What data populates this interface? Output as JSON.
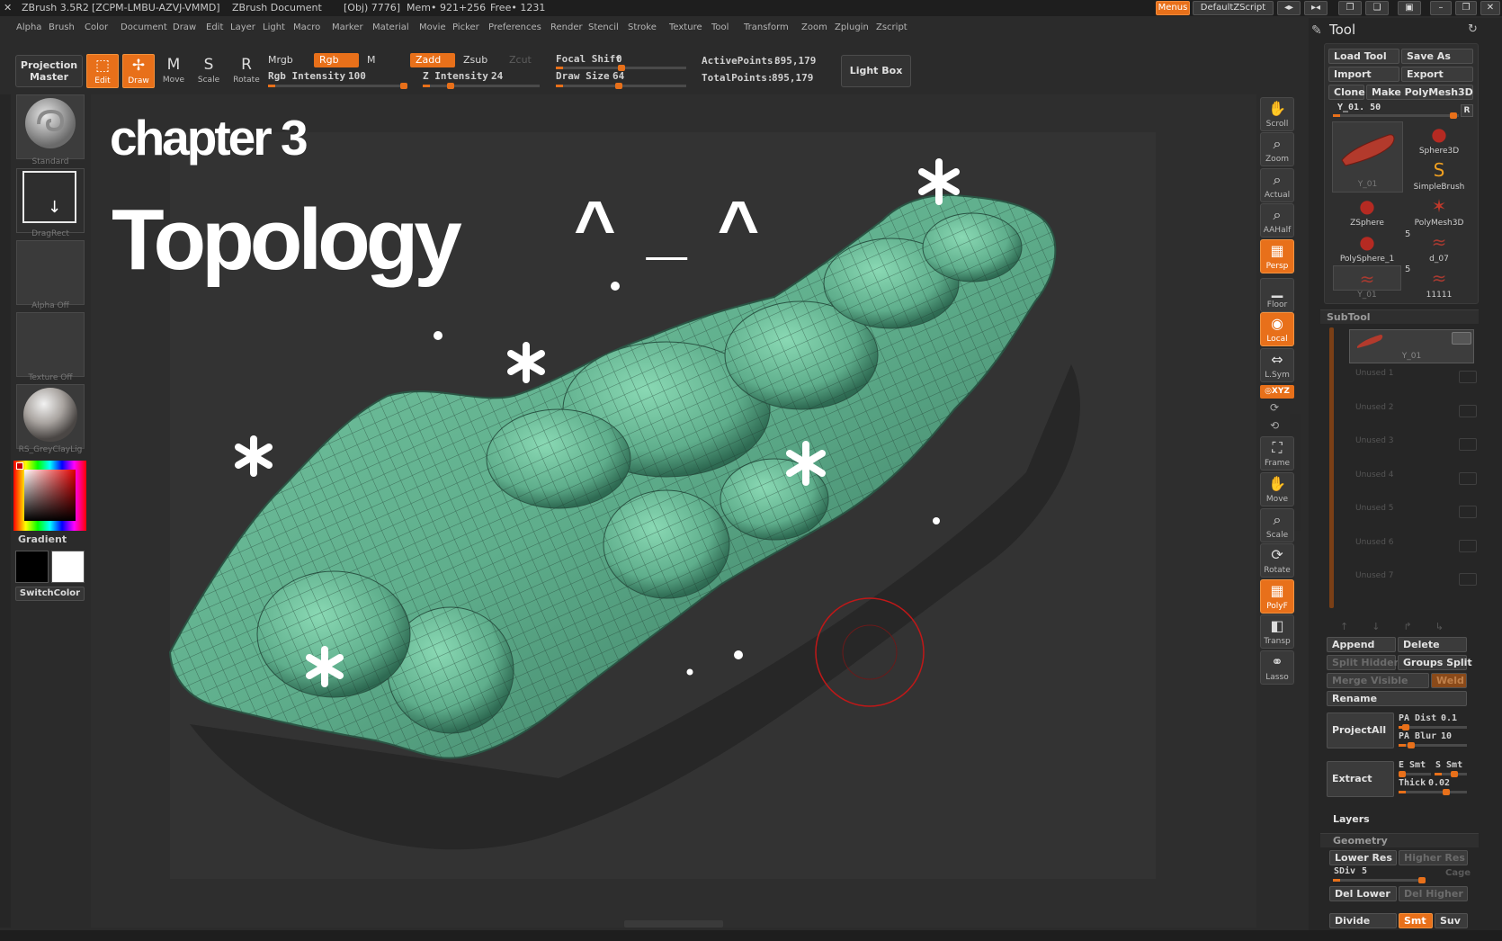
{
  "titlebar": {
    "app": "ZBrush 3.5R2",
    "serial": "[ZCPM-LMBU-AZVJ-VMMD]",
    "document": "ZBrush Document",
    "obj": "[Obj) 7776]",
    "mem": "Mem• 921+256",
    "free": "Free• 1231",
    "menus_label": "Menus",
    "script_label": "DefaultZScript"
  },
  "menubar": [
    "Alpha",
    "Brush",
    "Color",
    "Document",
    "Draw",
    "Edit",
    "Layer",
    "Light",
    "Macro",
    "Marker",
    "Material",
    "Movie",
    "Picker",
    "Preferences",
    "Render",
    "Stencil",
    "Stroke",
    "Texture",
    "Tool",
    "Transform",
    "Zoom",
    "Zplugin",
    "Zscript"
  ],
  "toolbar": {
    "projection_master": [
      "Projection",
      "Master"
    ],
    "edit": "Edit",
    "draw": "Draw",
    "move": "Move",
    "scale": "Scale",
    "rotate": "Rotate",
    "mrgb": "Mrgb",
    "rgb": "Rgb",
    "m": "M",
    "zadd": "Zadd",
    "zsub": "Zsub",
    "zcut": "Zcut",
    "rgb_intensity_label": "Rgb Intensity",
    "rgb_intensity": "100",
    "rgb_intensity_level": 100,
    "z_intensity_label": "Z Intensity",
    "z_intensity": "24",
    "z_intensity_level": 24,
    "focal_shift_label": "Focal Shift",
    "focal_shift": "0",
    "focal_shift_level": 50,
    "draw_size_label": "Draw Size",
    "draw_size": "64",
    "draw_size_level": 48,
    "active_points_label": "ActivePoints:",
    "active_points": "895,179",
    "total_points_label": "TotalPoints:",
    "total_points": "895,179",
    "light_box": "Light Box"
  },
  "left_shelf": {
    "brush_caption": "Standard",
    "stroke_caption": "DragRect",
    "alpha_caption": "Alpha Off",
    "texture_caption": "Texture Off",
    "material_caption": "RS_GreyClayLig",
    "gradient": "Gradient",
    "switch_color": "SwitchColor",
    "main_color": "#000000",
    "secondary_color": "#ffffff"
  },
  "canvas": {
    "heading_small": "chapter 3",
    "heading_big": "Topology",
    "emoticon": "^ _ ^",
    "mesh_color": "#5fae8c"
  },
  "right_shelf": [
    {
      "name": "scroll",
      "label": "Scroll",
      "icon": "hand-icon",
      "on": false
    },
    {
      "name": "zoom",
      "label": "Zoom",
      "icon": "magnifier-icon",
      "on": false
    },
    {
      "name": "actual",
      "label": "Actual",
      "icon": "magnifier-icon",
      "on": false
    },
    {
      "name": "aahalf",
      "label": "AAHalf",
      "icon": "magnifier-icon",
      "on": false
    },
    {
      "name": "persp",
      "label": "Persp",
      "icon": "grid-icon",
      "on": true
    },
    {
      "name": "floor",
      "label": "Floor",
      "icon": "floor-icon",
      "on": false
    },
    {
      "name": "local",
      "label": "Local",
      "icon": "target-icon",
      "on": true
    },
    {
      "name": "lsym",
      "label": "L.Sym",
      "icon": "arrows-icon",
      "on": false
    },
    {
      "name": "frame",
      "label": "Frame",
      "icon": "frame-icon",
      "on": false
    },
    {
      "name": "move",
      "label": "Move",
      "icon": "hand-icon",
      "on": false
    },
    {
      "name": "scale",
      "label": "Scale",
      "icon": "magnifier-icon",
      "on": false
    },
    {
      "name": "rotate",
      "label": "Rotate",
      "icon": "rotate-icon",
      "on": false
    },
    {
      "name": "polyf",
      "label": "PolyF",
      "icon": "grid-icon",
      "on": true
    },
    {
      "name": "transp",
      "label": "Transp",
      "icon": "cube-icon",
      "on": false
    },
    {
      "name": "lasso",
      "label": "Lasso",
      "icon": "lasso-icon",
      "on": false
    }
  ],
  "xyz_label": "◎XYZ",
  "tool_palette": {
    "title": "Tool",
    "load_tool": "Load Tool",
    "save_as": "Save As",
    "import": "Import",
    "export": "Export",
    "clone": "Clone",
    "make_polymesh": "Make PolyMesh3D",
    "current_tool_label": "Y_01. 50",
    "current_tool_level": 96,
    "r_button": "R",
    "current_tool_caption": "Y_01",
    "tools": [
      {
        "name": "Sphere3D",
        "icon": "sphere-icon"
      },
      {
        "name": "SimpleBrush",
        "icon": "s-brush-icon"
      },
      {
        "name": "ZSphere",
        "icon": "sphere-icon"
      },
      {
        "name": "PolyMesh3D",
        "icon": "star-icon"
      },
      {
        "name": "PolySphere_1",
        "icon": "sphere-icon"
      },
      {
        "name": "d_07",
        "icon": "mesh-icon"
      },
      {
        "name": "Y_01",
        "icon": "mesh-icon"
      },
      {
        "name": "11111",
        "icon": "mesh-icon"
      }
    ],
    "count_a": "5",
    "count_b": "5",
    "subtool_title": "SubTool",
    "subtool_active": "Y_01",
    "unused": [
      "Unused 1",
      "Unused 2",
      "Unused 3",
      "Unused 4",
      "Unused 5",
      "Unused 6",
      "Unused 7"
    ],
    "append": "Append",
    "delete": "Delete",
    "split_hidden": "Split Hidden",
    "groups_split": "Groups Split",
    "merge_visible": "Merge Visible",
    "weld": "Weld",
    "rename": "Rename",
    "project_all": "ProjectAll",
    "pa_dist_label": "PA Dist",
    "pa_dist": "0.1",
    "pa_dist_level": 10,
    "pa_blur_label": "PA Blur",
    "pa_blur": "10",
    "pa_blur_level": 18,
    "extract": "Extract",
    "e_smt": "E Smt",
    "s_smt": "S Smt",
    "e_smt_level": 12,
    "s_smt_level": 60,
    "thick_label": "Thick",
    "thick": "0.02",
    "thick_level": 70,
    "layers_title": "Layers",
    "geometry_title": "Geometry",
    "lower_res": "Lower Res",
    "higher_res": "Higher Res",
    "sdiv_label": "SDiv",
    "sdiv": "5",
    "sdiv_level": 100,
    "cage": "Cage",
    "del_lower": "Del Lower",
    "del_higher": "Del Higher",
    "divide": "Divide",
    "smt": "Smt",
    "suv": "Suv"
  }
}
